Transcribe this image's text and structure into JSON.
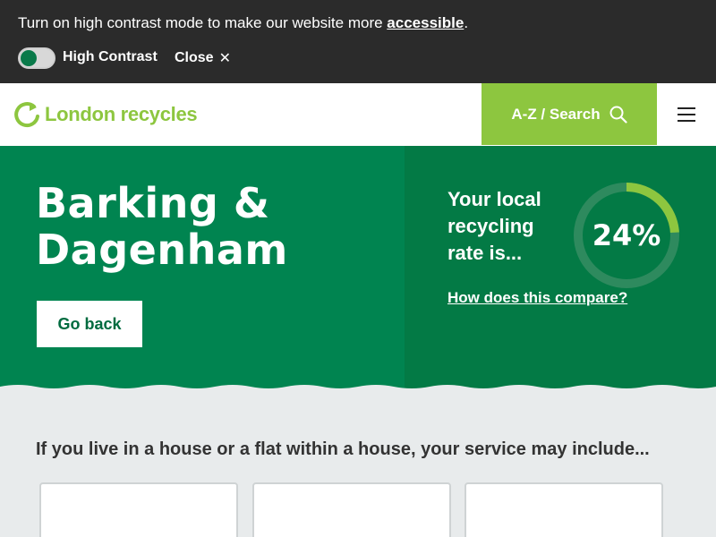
{
  "contrast_bar": {
    "message": "Turn on high contrast mode to make our website more ",
    "link_text": "accessible",
    "period": ".",
    "toggle_label": "High Contrast",
    "close_label": "Close",
    "close_icon": "✕"
  },
  "header": {
    "logo_text": "London recycles",
    "logo_icon": "recycle-arrow-icon",
    "search_label": "A-Z / Search",
    "search_icon": "search-icon",
    "menu_icon": "hamburger-menu-icon"
  },
  "hero": {
    "borough_line1": "Barking &",
    "borough_line2": "Dagenham",
    "go_back": "Go back",
    "rate_label": "Your local recycling rate is...",
    "rate_value": "24%",
    "rate_percent": 24,
    "compare_link": "How does this compare?"
  },
  "services": {
    "heading": "If you live in a house or a flat within a house, your service may include..."
  },
  "colors": {
    "brand_green": "#8dc63f",
    "hero_green": "#008450",
    "hero_green_dark": "#037a45",
    "contrast_bar": "#2b2b2b",
    "page_bg": "#e8ebec"
  }
}
